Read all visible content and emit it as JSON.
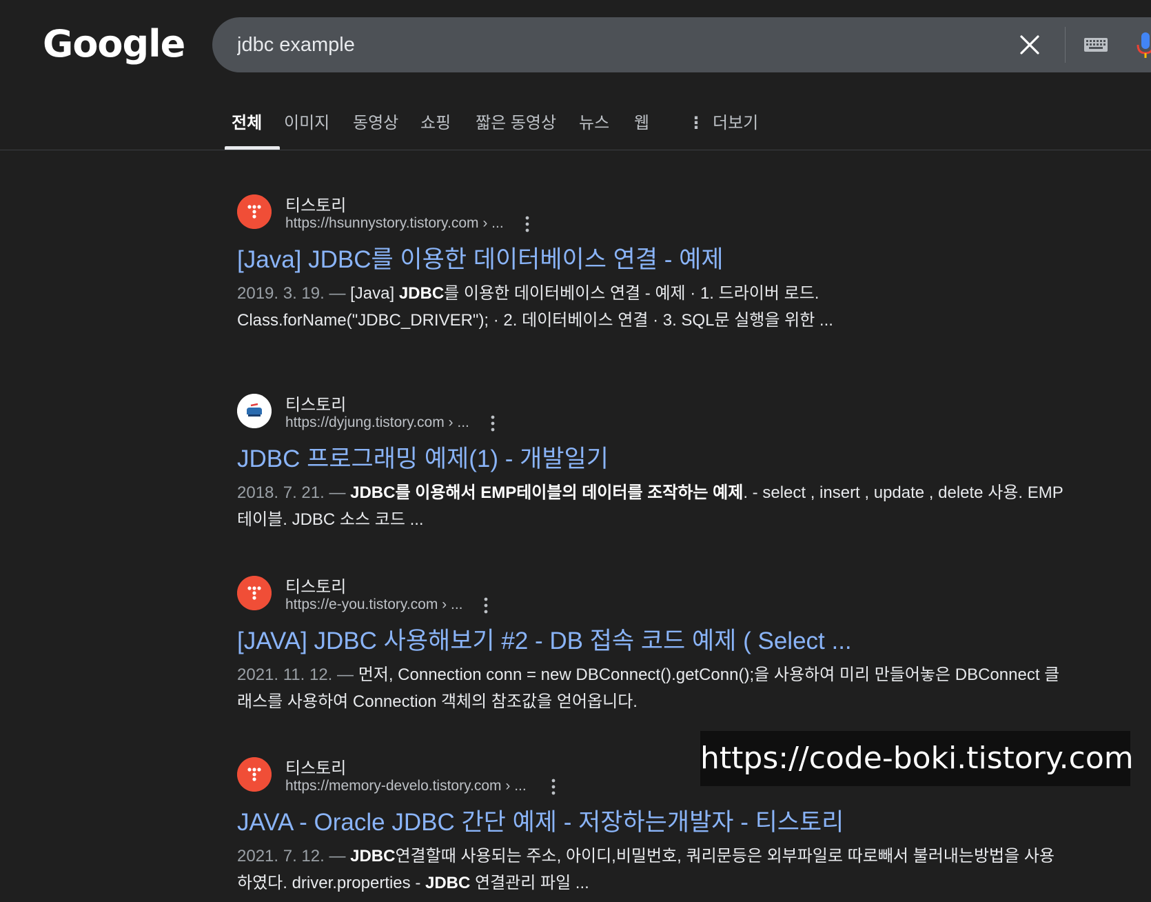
{
  "logo": "Google",
  "search": {
    "query": "jdbc example"
  },
  "icons": {
    "clear": "close-icon",
    "keyboard": "keyboard-icon",
    "voice": "microphone-icon",
    "more": "vertical-dots-icon"
  },
  "tabs": [
    {
      "label": "전체",
      "active": true
    },
    {
      "label": "이미지"
    },
    {
      "label": "동영상"
    },
    {
      "label": "쇼핑"
    },
    {
      "label": "짧은 동영상"
    },
    {
      "label": "뉴스"
    },
    {
      "label": "웹"
    },
    {
      "label": "더보기"
    }
  ],
  "results": [
    {
      "site": "티스토리",
      "url": "https://hsunnystory.tistory.com › ...",
      "title": "[Java] JDBC를 이용한 데이터베이스 연결 - 예제",
      "date": "2019. 3. 19. —",
      "snippet_html": "[Java] <b>JDBC</b>를 이용한 데이터베이스 연결 - 예제 · 1. 드라이버 로드. Class.forName(\"JDBC_DRIVER\"); · 2. 데이터베이스 연결 · 3. SQL문 실행을 위한 ..."
    },
    {
      "site": "티스토리",
      "url": "https://dyjung.tistory.com › ...",
      "title": "JDBC 프로그래밍 예제(1) - 개발일기",
      "date": "2018. 7. 21. —",
      "snippet_html": "<b>JDBC를 이용해서 EMP테이블의 데이터를 조작하는 예제</b>. - select , insert , update , delete 사용. EMP테이블. JDBC 소스 코드 ..."
    },
    {
      "site": "티스토리",
      "url": "https://e-you.tistory.com › ...",
      "title": "[JAVA] JDBC 사용해보기 #2 - DB 접속 코드 예제 ( Select ...",
      "date": "2021. 11. 12. —",
      "snippet_html": "먼저, Connection conn = new DBConnect().getConn();을 사용하여 미리 만들어놓은 DBConnect 클래스를 사용하여 Connection 객체의 참조값을 얻어옵니다."
    },
    {
      "site": "티스토리",
      "url": "https://memory-develo.tistory.com › ...",
      "title": "JAVA - Oracle JDBC 간단 예제 - 저장하는개발자 - 티스토리",
      "date": "2021. 7. 12. —",
      "snippet_html": "<b>JDBC</b>연결할때 사용되는 주소, 아이디,비밀번호, 쿼리문등은 외부파일로 따로빼서 불러내는방법을 사용하였다. driver.properties - <b>JDBC</b> 연결관리 파일 ..."
    }
  ],
  "watermark": "https://code-boki.tistory.com",
  "colors": {
    "background": "#1f1f1f",
    "link": "#8ab4f8",
    "favicon_tistory": "#f04e37",
    "searchbar": "#4d5156"
  }
}
